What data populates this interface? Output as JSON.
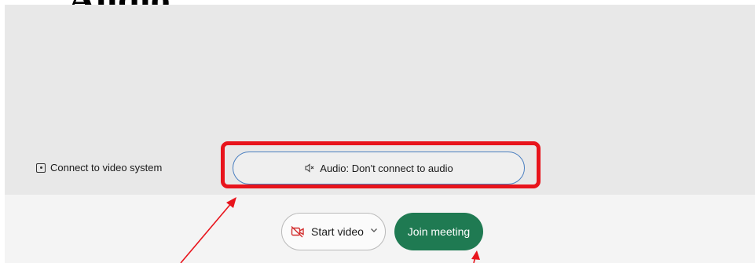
{
  "heading": "Audio",
  "connect_video": {
    "label": "Connect to video system",
    "icon": "video-system-icon"
  },
  "audio": {
    "label": "Audio: Don't connect to audio",
    "icon": "speaker-muted-icon"
  },
  "start_video": {
    "label": "Start video",
    "icon": "camera-off-icon",
    "menu_icon": "chevron-down-icon"
  },
  "join": {
    "label": "Join meeting"
  },
  "colors": {
    "panel_bg": "#e8e8e8",
    "footer_bg": "#f4f4f4",
    "highlight": "#e8141c",
    "join_bg": "#1f7a52",
    "audio_border": "#4a7fc0",
    "camera_off": "#d32f2f"
  }
}
